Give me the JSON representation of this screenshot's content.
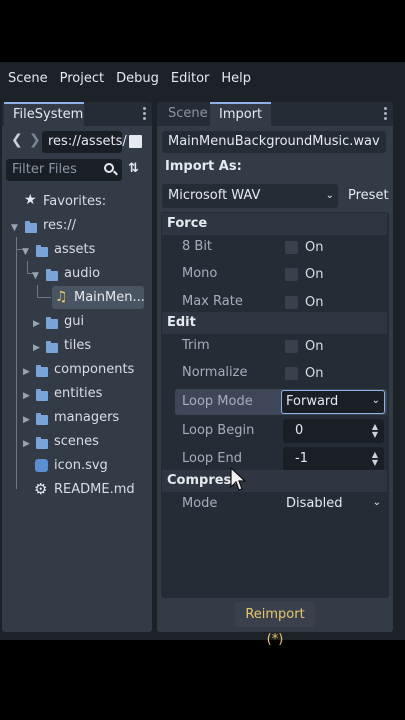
{
  "menubar": {
    "items": [
      "Scene",
      "Project",
      "Debug",
      "Editor",
      "Help"
    ]
  },
  "filesystem": {
    "tab_label": "FileSystem",
    "path": "res://assets/",
    "filter_placeholder": "Filter Files",
    "favorites_label": "Favorites:",
    "tree": {
      "root": "res://",
      "assets": "assets",
      "audio": "audio",
      "selected_file": "MainMen...",
      "gui": "gui",
      "tiles": "tiles",
      "components": "components",
      "entities": "entities",
      "managers": "managers",
      "scenes": "scenes",
      "icon_file": "icon.svg",
      "readme_file": "README.md"
    }
  },
  "inspector": {
    "tabs": [
      "Scene",
      "Import"
    ],
    "active_tab": "Import",
    "filename": "MainMenuBackgroundMusic.wav",
    "import_as_label": "Import As:",
    "import_as_value": "Microsoft WAV",
    "preset_label": "Preset",
    "sections": {
      "force": "Force",
      "edit": "Edit",
      "compress": "Compress"
    },
    "properties": {
      "bit8": {
        "label": "8 Bit",
        "value": "On"
      },
      "mono": {
        "label": "Mono",
        "value": "On"
      },
      "max_rate": {
        "label": "Max Rate",
        "value": "On"
      },
      "trim": {
        "label": "Trim",
        "value": "On"
      },
      "normalize": {
        "label": "Normalize",
        "value": "On"
      },
      "loop_mode": {
        "label": "Loop Mode",
        "value": "Forward"
      },
      "loop_begin": {
        "label": "Loop Begin",
        "value": "0"
      },
      "loop_end": {
        "label": "Loop End",
        "value": "-1"
      },
      "mode": {
        "label": "Mode",
        "value": "Disabled"
      }
    },
    "reimport_label": "Reimport (*)"
  },
  "colors": {
    "accent": "#8fb2e6",
    "folder": "#7aa3d9",
    "reimport_text": "#e8c76a"
  }
}
